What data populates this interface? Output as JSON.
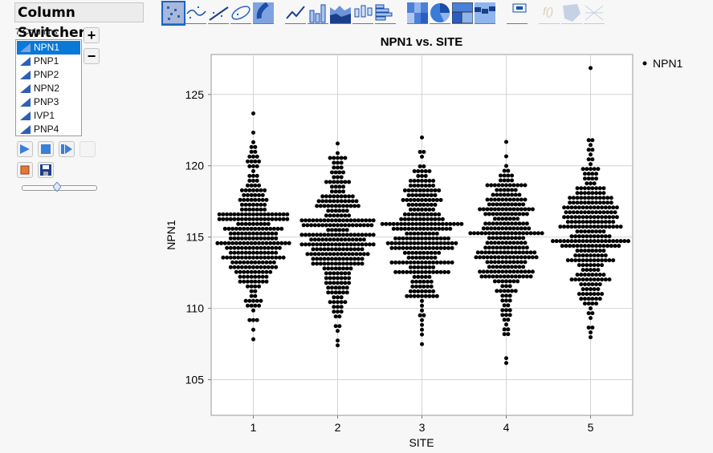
{
  "column_switcher": {
    "title": "Column Switcher",
    "count_label": "7 Columns",
    "columns": [
      "NPN1",
      "PNP1",
      "PNP2",
      "NPN2",
      "PNP3",
      "IVP1",
      "PNP4"
    ],
    "selected": "NPN1",
    "add_label": "+",
    "remove_label": "−",
    "slider_value": 0.5
  },
  "toolbar": {
    "icons": [
      "points-icon",
      "smoother-icon",
      "line-of-fit-icon",
      "ellipse-icon",
      "contour-icon",
      "line-icon",
      "bar-icon",
      "area-icon",
      "box-plot-icon",
      "histogram-icon",
      "heatmap-icon",
      "pie-icon",
      "treemap-icon",
      "mosaic-icon",
      "caption-box-icon",
      "formula-icon",
      "map-shapes-icon",
      "parallel-icon"
    ],
    "selected": "points-icon"
  },
  "colors": {
    "points": "#000000",
    "grid": "#d4d4d4",
    "accent": "#0a78d7"
  },
  "chart_data": {
    "type": "scatter",
    "style": "beeswarm",
    "title": "NPN1 vs. SITE",
    "xlabel": "SITE",
    "ylabel": "NPN1",
    "categories": [
      "1",
      "2",
      "3",
      "4",
      "5"
    ],
    "xlim": [
      0.5,
      5.5
    ],
    "ylim": [
      102.5,
      127.8
    ],
    "yticks": [
      105,
      110,
      115,
      120,
      125
    ],
    "grid": true,
    "legend": {
      "position": "right",
      "entries": [
        "NPN1"
      ]
    },
    "bin_width": 0.337,
    "series": [
      {
        "site": "1",
        "top_value": 123.67,
        "row_counts": [
          1,
          0,
          0,
          0,
          1,
          0,
          1,
          2,
          2,
          3,
          4,
          3,
          1,
          3,
          3,
          4,
          7,
          6,
          8,
          7,
          7,
          19,
          19,
          9,
          16,
          13,
          13,
          20,
          15,
          13,
          17,
          12,
          13,
          10,
          8,
          8,
          4,
          2,
          2,
          5,
          4,
          1,
          0,
          3,
          0,
          1,
          0,
          1
        ]
      },
      {
        "site": "2",
        "top_value": 121.56,
        "row_counts": [
          1,
          0,
          1,
          5,
          3,
          3,
          4,
          3,
          7,
          4,
          4,
          9,
          11,
          12,
          6,
          7,
          20,
          19,
          6,
          20,
          15,
          20,
          14,
          17,
          14,
          14,
          8,
          7,
          7,
          7,
          6,
          6,
          3,
          5,
          3,
          3,
          2,
          0,
          2,
          1,
          0,
          1,
          1
        ]
      },
      {
        "site": "3",
        "top_value": 121.98,
        "row_counts": [
          1,
          0,
          0,
          2,
          1,
          0,
          2,
          5,
          3,
          7,
          7,
          10,
          8,
          11,
          8,
          7,
          10,
          12,
          22,
          16,
          9,
          15,
          19,
          17,
          10,
          8,
          17,
          7,
          15,
          5,
          6,
          6,
          7,
          9,
          1,
          1,
          1,
          2,
          1,
          1,
          1,
          1,
          0,
          1
        ]
      },
      {
        "site": "4",
        "top_value": 121.67,
        "row_counts": [
          1,
          0,
          0,
          1,
          0,
          1,
          2,
          4,
          4,
          11,
          6,
          8,
          11,
          10,
          15,
          12,
          7,
          12,
          13,
          20,
          10,
          11,
          12,
          16,
          17,
          11,
          10,
          15,
          14,
          7,
          3,
          6,
          3,
          3,
          2,
          3,
          3,
          2,
          1,
          2,
          2,
          0,
          0,
          0,
          0,
          1,
          1
        ]
      },
      {
        "site": "5",
        "top_value": 126.85,
        "row_counts": [
          1,
          0,
          0,
          0,
          0,
          0,
          0,
          0,
          0,
          0,
          0,
          0,
          0,
          0,
          0,
          2,
          1,
          2,
          1,
          2,
          1,
          5,
          4,
          4,
          3,
          8,
          8,
          12,
          12,
          15,
          14,
          15,
          13,
          17,
          8,
          11,
          21,
          16,
          8,
          9,
          13,
          7,
          5,
          8,
          11,
          6,
          5,
          7,
          6,
          4,
          1,
          2,
          1,
          0,
          2,
          1,
          1
        ]
      }
    ]
  }
}
